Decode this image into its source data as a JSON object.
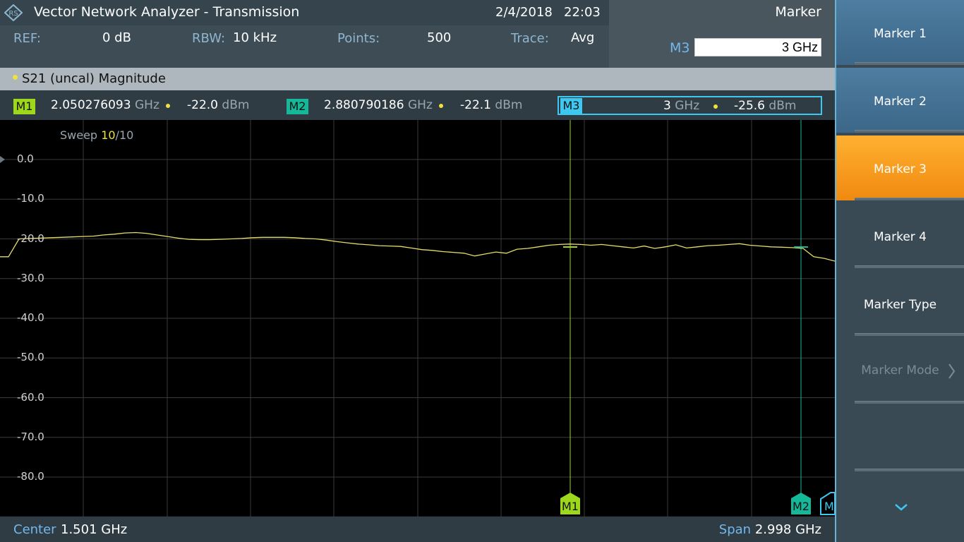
{
  "header": {
    "title": "Vector Network Analyzer - Transmission",
    "date": "2/4/2018",
    "time": "22:03",
    "params": [
      {
        "label": "REF:",
        "value": "0 dB"
      },
      {
        "label": "RBW:",
        "value": "10 kHz"
      },
      {
        "label": "Points:",
        "value": "500"
      },
      {
        "label": "Trace:",
        "value": "Avg"
      }
    ]
  },
  "marker_panel": {
    "title": "Marker",
    "entry_label": "M3",
    "entry_value": "3 GHz"
  },
  "trace": {
    "title": "S21 (uncal) Magnitude",
    "color": "#f0e040"
  },
  "markers": [
    {
      "name": "M1",
      "freq": "2.050276093",
      "freq_unit": "GHz",
      "level": "-22.0",
      "level_unit": "dBm",
      "color": "#9ed81a"
    },
    {
      "name": "M2",
      "freq": "2.880790186",
      "freq_unit": "GHz",
      "level": "-22.1",
      "level_unit": "dBm",
      "color": "#16b89a"
    },
    {
      "name": "M3",
      "freq": "3",
      "freq_unit": "GHz",
      "level": "-25.6",
      "level_unit": "dBm",
      "color": "#3cc8f0"
    }
  ],
  "plot": {
    "sweep_label": "Sweep",
    "sweep_current": "10",
    "sweep_total": "/10",
    "y_ticks": [
      "0.0",
      "-10.0",
      "-20.0",
      "-30.0",
      "-40.0",
      "-50.0",
      "-60.0",
      "-70.0",
      "-80.0"
    ],
    "marker_flags": [
      "M1",
      "M2",
      "M"
    ],
    "trace_db": [
      -24.5,
      -24.5,
      -20.0,
      -19.9,
      -19.8,
      -19.7,
      -19.6,
      -19.5,
      -19.4,
      -19.3,
      -19.0,
      -18.8,
      -18.5,
      -18.4,
      -18.6,
      -19.0,
      -19.4,
      -19.8,
      -20.1,
      -20.2,
      -20.2,
      -20.1,
      -20.0,
      -19.9,
      -19.7,
      -19.6,
      -19.6,
      -19.6,
      -19.7,
      -19.9,
      -20.0,
      -20.3,
      -20.7,
      -21.0,
      -21.3,
      -21.5,
      -21.7,
      -21.8,
      -21.9,
      -22.3,
      -22.7,
      -22.9,
      -23.2,
      -23.4,
      -23.6,
      -24.3,
      -23.8,
      -23.3,
      -23.6,
      -22.6,
      -22.4,
      -22.0,
      -21.6,
      -21.4,
      -21.3,
      -21.4,
      -21.6,
      -21.4,
      -21.7,
      -22.0,
      -22.3,
      -21.8,
      -22.4,
      -22.0,
      -21.5,
      -22.3,
      -22.0,
      -21.7,
      -21.6,
      -21.4,
      -21.2,
      -21.6,
      -21.8,
      -22.0,
      -22.1,
      -22.2,
      -22.4,
      -24.5,
      -24.9,
      -25.6
    ]
  },
  "footer": {
    "center_label": "Center",
    "center_value": "1.501 GHz",
    "span_label": "Span",
    "span_value": "2.998 GHz"
  },
  "softkeys": [
    {
      "label": "Marker 1",
      "state": "normal"
    },
    {
      "label": "Marker 2",
      "state": "normal"
    },
    {
      "label": "Marker 3",
      "state": "selected"
    },
    {
      "label": "Marker 4",
      "state": "plain"
    },
    {
      "label": "Marker Type",
      "state": "plain"
    },
    {
      "label": "Marker Mode",
      "state": "disabled"
    },
    {
      "label": "",
      "state": "plain"
    },
    {
      "label": "",
      "state": "plain"
    }
  ],
  "icons": {
    "logo": "rohde-schwarz-logo-icon",
    "more": "chevron-down-icon",
    "submenu": "chevron-right-icon"
  }
}
